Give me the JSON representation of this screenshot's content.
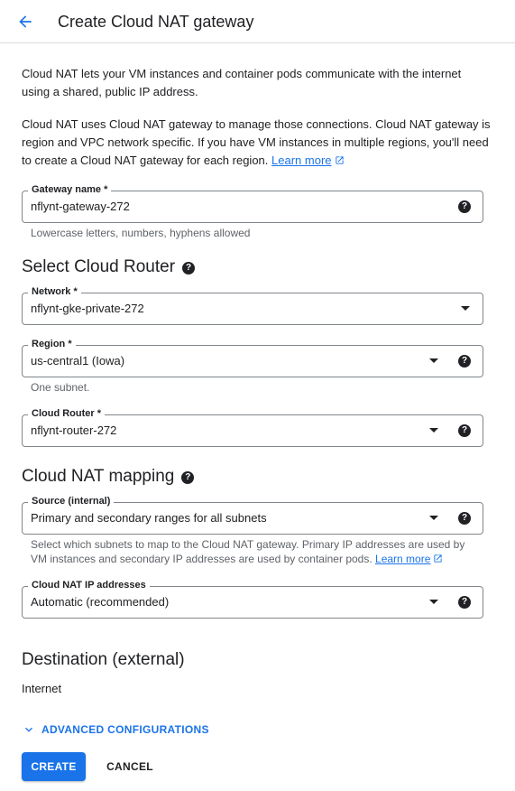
{
  "header": {
    "title": "Create Cloud NAT gateway",
    "back_icon": "arrow-back-icon"
  },
  "intro": {
    "para1": "Cloud NAT lets your VM instances and container pods communicate with the internet using a shared, public IP address.",
    "para2": "Cloud NAT uses Cloud NAT gateway to manage those connections. Cloud NAT gateway is region and VPC network specific. If you have VM instances in multiple regions, you'll need to create a Cloud NAT gateway for each region.",
    "learn_more": "Learn more"
  },
  "gateway": {
    "label": "Gateway name *",
    "value": "nflynt-gateway-272",
    "hint": "Lowercase letters, numbers, hyphens allowed"
  },
  "router_section": {
    "title": "Select Cloud Router",
    "network": {
      "label": "Network *",
      "value": "nflynt-gke-private-272"
    },
    "region": {
      "label": "Region *",
      "value": "us-central1 (Iowa)",
      "hint": "One subnet."
    },
    "cloud_router": {
      "label": "Cloud Router *",
      "value": "nflynt-router-272"
    }
  },
  "mapping_section": {
    "title": "Cloud NAT mapping",
    "source": {
      "label": "Source (internal)",
      "value": "Primary and secondary ranges for all subnets",
      "hint": "Select which subnets to map to the Cloud NAT gateway. Primary IP addresses are used by VM instances and secondary IP addresses are used by container pods.",
      "learn_more": "Learn more"
    },
    "ip_addresses": {
      "label": "Cloud NAT IP addresses",
      "value": "Automatic (recommended)"
    }
  },
  "destination": {
    "title": "Destination (external)",
    "value": "Internet"
  },
  "advanced": {
    "label": "ADVANCED CONFIGURATIONS"
  },
  "actions": {
    "create": "CREATE",
    "cancel": "CANCEL"
  },
  "colors": {
    "accent": "#1a73e8",
    "text": "#202124",
    "hint": "#5f6368",
    "border": "#80868b"
  }
}
